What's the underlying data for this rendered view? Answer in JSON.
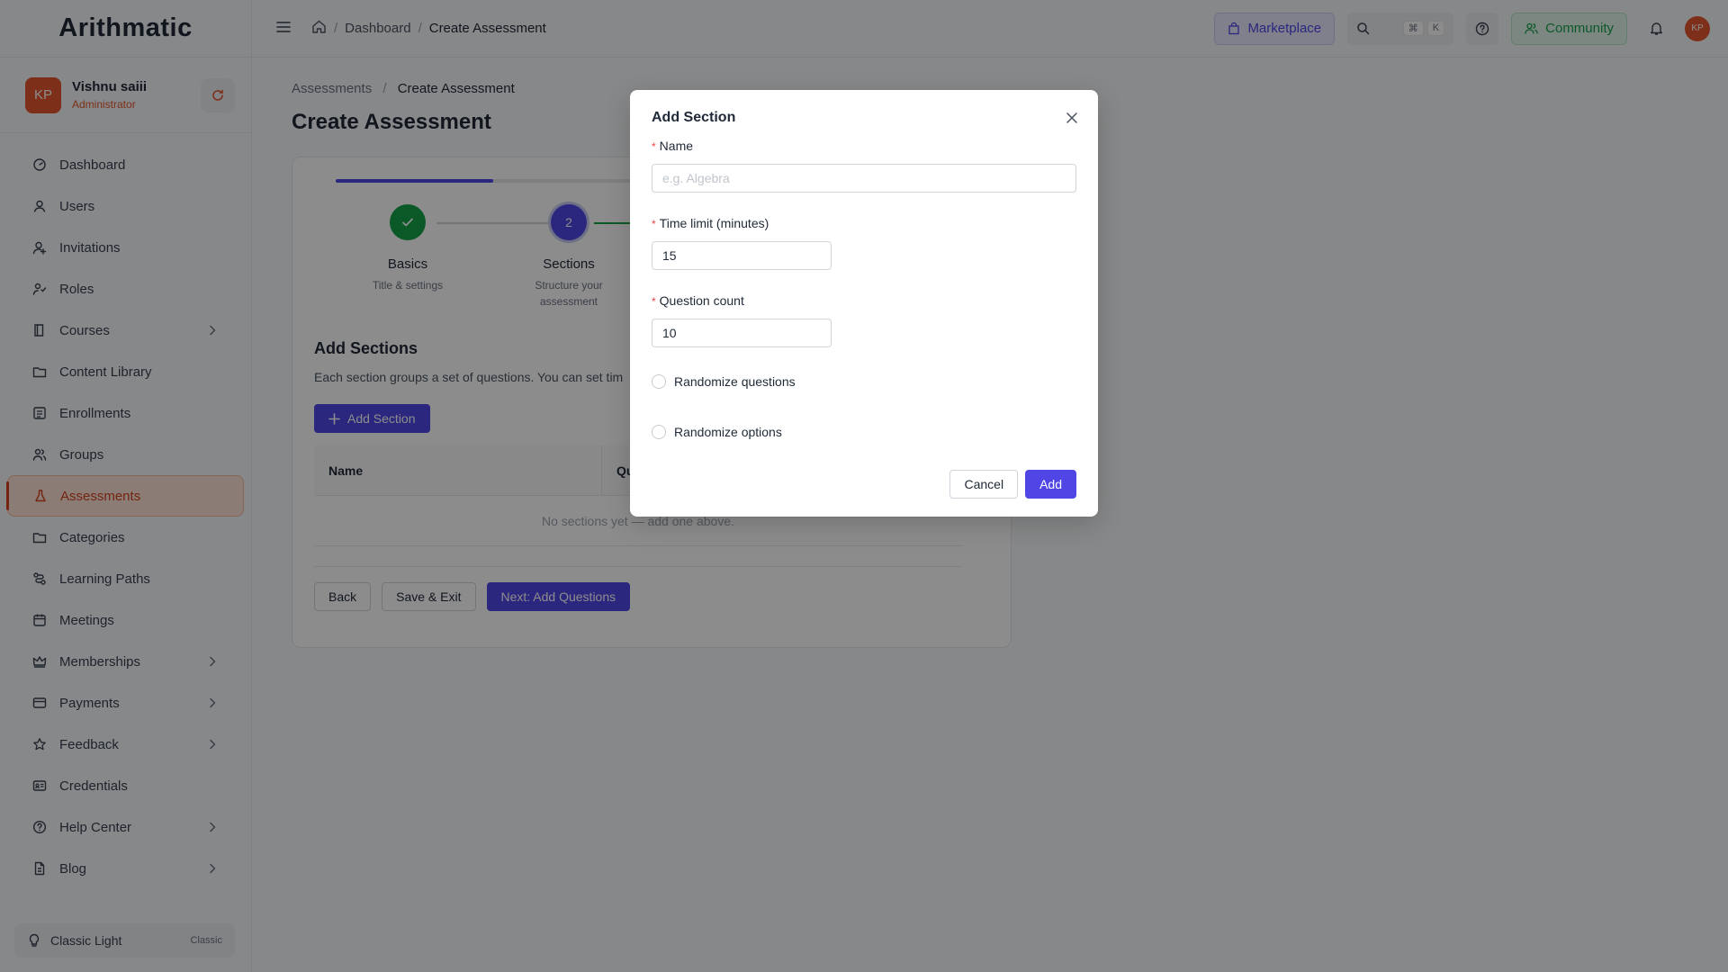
{
  "app": {
    "logo": "Arithmatic"
  },
  "profile": {
    "initials": "KP",
    "name": "Vishnu saiii",
    "role": "Administrator"
  },
  "sidebar": {
    "items": [
      {
        "label": "Dashboard",
        "icon": "dashboard-icon",
        "chevron": false,
        "active": false
      },
      {
        "label": "Users",
        "icon": "user-icon",
        "chevron": false,
        "active": false
      },
      {
        "label": "Invitations",
        "icon": "invite-icon",
        "chevron": false,
        "active": false
      },
      {
        "label": "Roles",
        "icon": "roles-icon",
        "chevron": false,
        "active": false
      },
      {
        "label": "Courses",
        "icon": "book-icon",
        "chevron": true,
        "active": false
      },
      {
        "label": "Content Library",
        "icon": "folder-icon",
        "chevron": false,
        "active": false
      },
      {
        "label": "Enrollments",
        "icon": "list-icon",
        "chevron": false,
        "active": false
      },
      {
        "label": "Groups",
        "icon": "group-icon",
        "chevron": false,
        "active": false
      },
      {
        "label": "Assessments",
        "icon": "flask-icon",
        "chevron": false,
        "active": true
      },
      {
        "label": "Categories",
        "icon": "folder-icon",
        "chevron": false,
        "active": false
      },
      {
        "label": "Learning Paths",
        "icon": "path-icon",
        "chevron": false,
        "active": false
      },
      {
        "label": "Meetings",
        "icon": "calendar-icon",
        "chevron": false,
        "active": false
      },
      {
        "label": "Memberships",
        "icon": "crown-icon",
        "chevron": true,
        "active": false
      },
      {
        "label": "Payments",
        "icon": "card-icon",
        "chevron": true,
        "active": false
      },
      {
        "label": "Feedback",
        "icon": "star-icon",
        "chevron": true,
        "active": false
      },
      {
        "label": "Credentials",
        "icon": "id-icon",
        "chevron": false,
        "active": false
      },
      {
        "label": "Help Center",
        "icon": "help-icon",
        "chevron": true,
        "active": false
      },
      {
        "label": "Blog",
        "icon": "doc-icon",
        "chevron": true,
        "active": false
      }
    ],
    "theme": {
      "label": "Classic Light",
      "mode": "Classic"
    }
  },
  "topbar": {
    "breadcrumb": [
      "Dashboard",
      "Create Assessment"
    ],
    "marketplace_label": "Marketplace",
    "kbd": [
      "⌘",
      "K"
    ],
    "community_label": "Community",
    "avatar_initials": "KP"
  },
  "page": {
    "breadcrumb": [
      "Assessments",
      "Create Assessment"
    ],
    "title": "Create Assessment",
    "progress_fraction": 0.25,
    "steps": [
      {
        "title": "Basics",
        "desc": "Title & settings",
        "status": "done",
        "number": ""
      },
      {
        "title": "Sections",
        "desc": "Structure your assessment",
        "status": "current",
        "number": "2"
      }
    ],
    "section_title": "Add Sections",
    "section_desc": "Each section groups a set of questions. You can set tim",
    "add_section_label": "Add Section",
    "table": {
      "headers": [
        "Name",
        "Qu"
      ],
      "empty_text": "No sections yet — add one above."
    },
    "buttons": {
      "back": "Back",
      "save_exit": "Save & Exit",
      "next": "Next: Add Questions"
    }
  },
  "modal": {
    "title": "Add Section",
    "name": {
      "label": "Name",
      "placeholder": "e.g. Algebra",
      "value": ""
    },
    "time_limit": {
      "label": "Time limit (minutes)",
      "value": "15"
    },
    "question_count": {
      "label": "Question count",
      "value": "10"
    },
    "randomize_questions": {
      "label": "Randomize questions",
      "checked": false
    },
    "randomize_options": {
      "label": "Randomize options",
      "checked": false
    },
    "cancel_label": "Cancel",
    "add_label": "Add"
  },
  "colors": {
    "accent": "#4f46e5",
    "brand": "#e4572e",
    "success": "#16a34a"
  }
}
